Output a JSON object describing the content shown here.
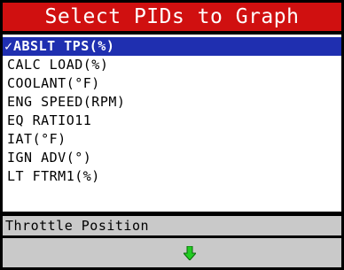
{
  "header": {
    "title": "Select PIDs to Graph"
  },
  "pid_list": {
    "check_mark": "✓",
    "items": [
      {
        "label": "ABSLT TPS(%)",
        "selected": true
      },
      {
        "label": "CALC LOAD(%)",
        "selected": false
      },
      {
        "label": "COOLANT(°F)",
        "selected": false
      },
      {
        "label": "ENG SPEED(RPM)",
        "selected": false
      },
      {
        "label": "EQ RATIO11",
        "selected": false
      },
      {
        "label": "IAT(°F)",
        "selected": false
      },
      {
        "label": "IGN ADV(°)",
        "selected": false
      },
      {
        "label": "LT FTRM1(%)",
        "selected": false
      }
    ]
  },
  "status": {
    "description": "Throttle Position"
  },
  "nav": {
    "icon": "down-arrow-icon",
    "icon_color": "#22cc22"
  },
  "colors": {
    "title_bg": "#d01010",
    "selection_bg": "#1f2fb0",
    "bar_bg": "#c9c9c9"
  }
}
